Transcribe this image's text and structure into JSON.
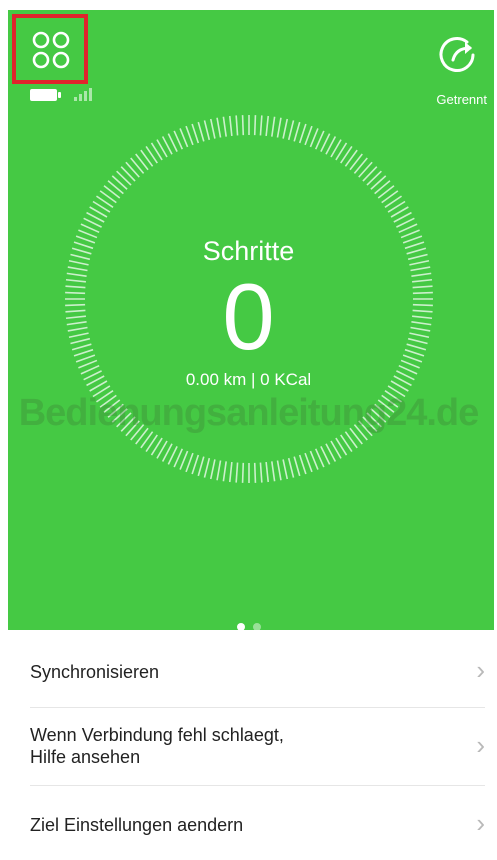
{
  "header": {
    "status_label": "Getrennt"
  },
  "icons": {
    "menu": "grid-four-circles-icon",
    "battery": "battery-icon",
    "signal": "signal-bars-icon",
    "share": "share-arrow-icon"
  },
  "dashboard": {
    "title": "Schritte",
    "steps": "0",
    "summary": "0.00 km | 0 KCal",
    "watermark": "Bedienungsanleitung24.de"
  },
  "pager": {
    "count": 2,
    "active_index": 0
  },
  "list": {
    "items": [
      {
        "label": "Synchronisieren"
      },
      {
        "label": "Wenn Verbindung fehl schlaegt,\nHilfe ansehen"
      },
      {
        "label": "Ziel Einstellungen aendern"
      }
    ],
    "chevron": "›"
  },
  "colors": {
    "accent_green": "#45c944",
    "highlight_red": "#e0242c"
  }
}
